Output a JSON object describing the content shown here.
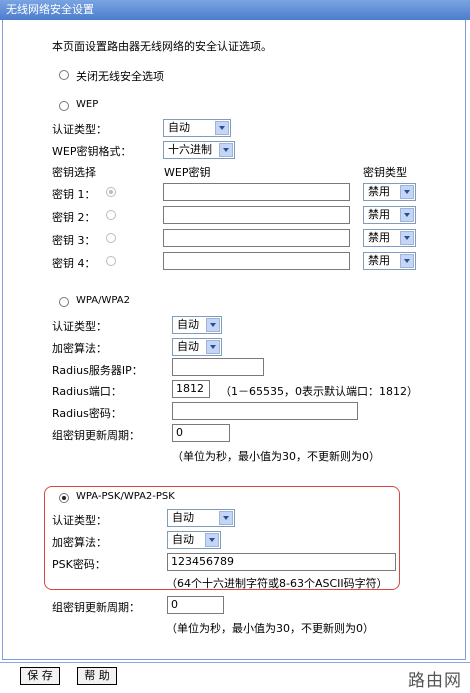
{
  "title": "无线网络安全设置",
  "intro": "本页面设置路由器无线网络的安全认证选项。",
  "disable_option": "关闭无线安全选项",
  "wep": {
    "label": "WEP",
    "auth_label": "认证类型：",
    "auth_value": "自动",
    "format_label": "WEP密钥格式：",
    "format_value": "十六进制",
    "col_select": "密钥选择",
    "col_key": "WEP密钥",
    "col_type": "密钥类型",
    "keys": [
      {
        "label": "密钥 1：",
        "type": "禁用"
      },
      {
        "label": "密钥 2：",
        "type": "禁用"
      },
      {
        "label": "密钥 3：",
        "type": "禁用"
      },
      {
        "label": "密钥 4：",
        "type": "禁用"
      }
    ]
  },
  "wpa": {
    "label": "WPA/WPA2",
    "auth_label": "认证类型：",
    "auth_value": "自动",
    "enc_label": "加密算法：",
    "enc_value": "自动",
    "radius_ip_label": "Radius服务器IP：",
    "radius_ip_value": "",
    "radius_port_label": "Radius端口：",
    "radius_port_value": "1812",
    "radius_port_hint": "（1－65535，0表示默认端口：1812）",
    "radius_pwd_label": "Radius密码：",
    "radius_pwd_value": "",
    "renew_label": "组密钥更新周期：",
    "renew_value": "0",
    "renew_hint": "（单位为秒，最小值为30，不更新则为0）"
  },
  "psk": {
    "label": "WPA-PSK/WPA2-PSK",
    "auth_label": "认证类型：",
    "auth_value": "自动",
    "enc_label": "加密算法：",
    "enc_value": "自动",
    "pwd_label": "PSK密码：",
    "pwd_value": "123456789",
    "pwd_hint": "（64个十六进制字符或8-63个ASCII码字符）",
    "renew_label": "组密钥更新周期：",
    "renew_value": "0",
    "renew_hint": "（单位为秒，最小值为30，不更新则为0）"
  },
  "buttons": {
    "save": "保 存",
    "help": "帮 助"
  },
  "watermark": "路由网"
}
